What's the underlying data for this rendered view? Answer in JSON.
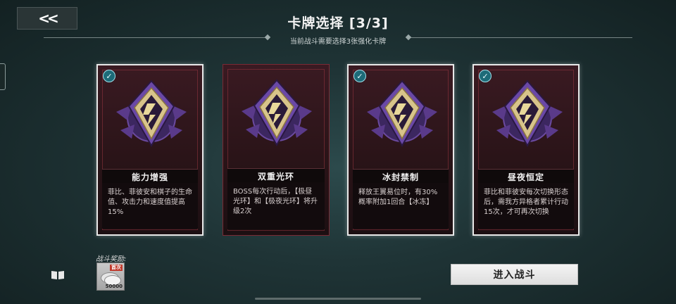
{
  "header": {
    "back_label": "<<",
    "title": "卡牌选择 [3/3]",
    "subtitle": "当前战斗需要选择3张强化卡牌"
  },
  "cards": [
    {
      "name": "能力增强",
      "description": "菲比、菲彼安和棋子的生命值、攻击力和速度值提高15%",
      "selected": true
    },
    {
      "name": "双重光环",
      "description": "BOSS每次行动后，【极昼光环】和【极夜光环】将升级2次",
      "selected": false
    },
    {
      "name": "冰封禁制",
      "description": "释放王翼易位时，有30%概率附加1回合【冰冻】",
      "selected": true
    },
    {
      "name": "昼夜恒定",
      "description": "菲比和菲彼安每次切换形态后，需我方异格者累计行动15次，才可再次切换",
      "selected": true
    }
  ],
  "reward": {
    "label": "战斗奖励:",
    "badge": "首次",
    "amount": "50000"
  },
  "icons": {
    "check": "checkmark-icon",
    "book": "book-icon",
    "emblem": "purple-gold-emblem-icon",
    "coin": "silver-coin-icon"
  },
  "enter_button": {
    "label": "进入战斗"
  },
  "colors": {
    "card_border": "#7a2a34",
    "selected_border": "#e8e8e8",
    "check": "#1d6b78",
    "emblem_purple": "#5a3a8a",
    "emblem_gold": "#d8c48a"
  }
}
